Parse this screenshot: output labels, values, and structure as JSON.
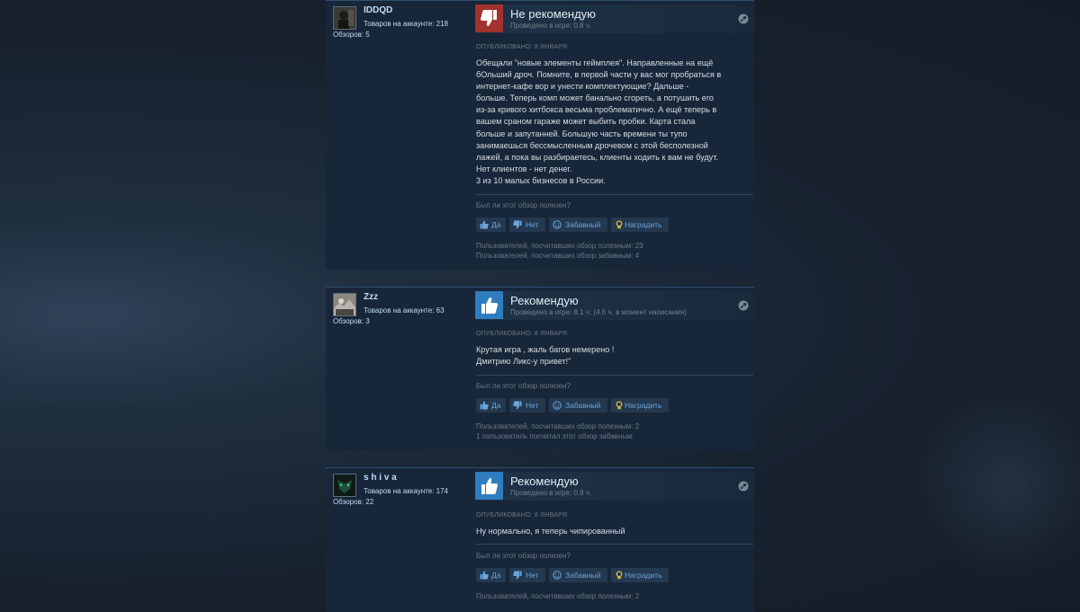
{
  "reviews": [
    {
      "author": {
        "name": "IDDQD",
        "products": "Товаров на аккаунте: 218",
        "reviews": "Обзоров: 5",
        "avatar": "dark-figure-avatar"
      },
      "vote": {
        "type": "down",
        "title": "Не рекомендую",
        "hours": "Проведено в игре: 0.8 ч.",
        "icon": "thumbs-down-icon"
      },
      "posted": "ОПУБЛИКОВАНО: 8 ЯНВАРЯ",
      "lines": [
        "Обещали \"новые элементы геймплея\". Направленные на ещё",
        "бОльший дроч. Помните, в первой части у вас мог пробраться в",
        "интернет-кафе вор и унести комплектующие? Дальше -",
        "больше. Теперь комп может банально сгореть, а потушить его",
        "из-за кривого хитбокса весьма проблематично. А ещё теперь в",
        "вашем сраном гараже может выбить пробки. Карта стала",
        "больше и запутанней. Большую часть времени ты тупо",
        "занимаешься бессмысленным дрочевом с этой бесполезной",
        "лажей, а пока вы разбираетесь, клиенты ходить к вам не будут.",
        "Нет клиентов - нет денег.",
        "3 из 10 малых бизнесов в России."
      ],
      "helpful_question": "Был ли этот обзор полезен?",
      "buttons": {
        "yes": "Да",
        "no": "Нет",
        "funny": "Забавный",
        "award": "Наградить"
      },
      "stats": [
        "Пользователей, посчитавших обзор полезным: 23",
        "Пользователей, посчитавших обзор забавным: 4"
      ]
    },
    {
      "author": {
        "name": "Zzz",
        "products": "Товаров на аккаунте: 63",
        "reviews": "Обзоров: 3",
        "avatar": "grey-photo-avatar"
      },
      "vote": {
        "type": "up",
        "title": "Рекомендую",
        "hours": "Проведено в игре: 8.1 ч. (4.6 ч. в момент написания)",
        "icon": "thumbs-up-icon"
      },
      "posted": "ОПУБЛИКОВАНО: 8 ЯНВАРЯ",
      "lines": [
        "Крутая игра , жаль багов немерено !",
        "Дмитрию Ликс-у привет!\""
      ],
      "helpful_question": "Был ли этот обзор полезен?",
      "buttons": {
        "yes": "Да",
        "no": "Нет",
        "funny": "Забавный",
        "award": "Наградить"
      },
      "stats": [
        "Пользователей, посчитавших обзор полезным: 2",
        "1 пользователь посчитал этот обзор забавным"
      ]
    },
    {
      "author": {
        "name": "s h i v a",
        "products": "Товаров на аккаунте: 174",
        "reviews": "Обзоров: 22",
        "avatar": "green-mask-avatar"
      },
      "vote": {
        "type": "up",
        "title": "Рекомендую",
        "hours": "Проведено в игре: 0.9 ч.",
        "icon": "thumbs-up-icon"
      },
      "posted": "ОПУБЛИКОВАНО: 8 ЯНВАРЯ",
      "lines": [
        "Ну нормально, я теперь чипированный"
      ],
      "helpful_question": "Был ли этот обзор полезен?",
      "buttons": {
        "yes": "Да",
        "no": "Нет",
        "funny": "Забавный",
        "award": "Наградить"
      },
      "stats": [
        "Пользователей, посчитавших обзор полезным: 2"
      ]
    }
  ],
  "colors": {
    "downvote": "#a3312d",
    "upvote": "#2e7dbf",
    "link_blue": "#69a5dc",
    "award_gold": "#e4c145"
  }
}
